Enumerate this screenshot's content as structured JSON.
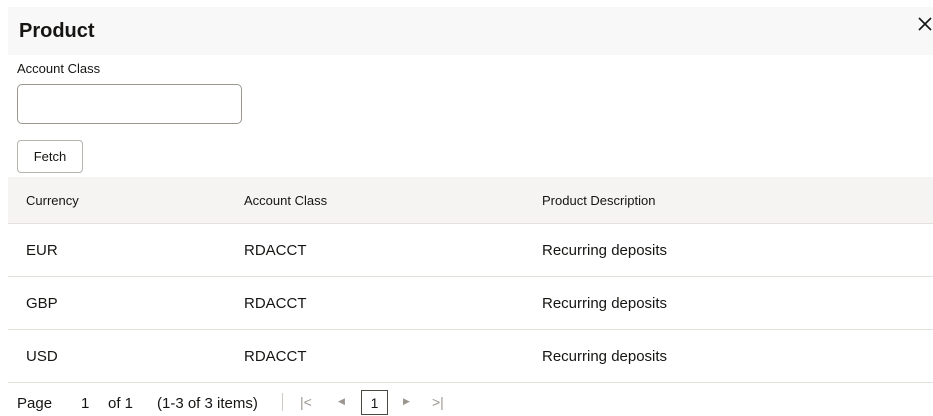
{
  "dialog": {
    "title": "Product",
    "close_label": "×"
  },
  "filter": {
    "account_class_label": "Account Class",
    "account_class_value": "",
    "fetch_label": "Fetch"
  },
  "table": {
    "columns": [
      "Currency",
      "Account Class",
      "Product Description"
    ],
    "rows": [
      [
        "EUR",
        "RDACCT",
        "Recurring deposits"
      ],
      [
        "GBP",
        "RDACCT",
        "Recurring deposits"
      ],
      [
        "USD",
        "RDACCT",
        "Recurring deposits"
      ]
    ]
  },
  "pagination": {
    "page_label": "Page",
    "page_number": "1",
    "of_label": "of 1",
    "items_label": "(1-3 of 3 items)",
    "current_page": "1",
    "first_icon": "|<",
    "prev_icon": "◀",
    "next_icon": "▶",
    "last_icon": ">|"
  }
}
